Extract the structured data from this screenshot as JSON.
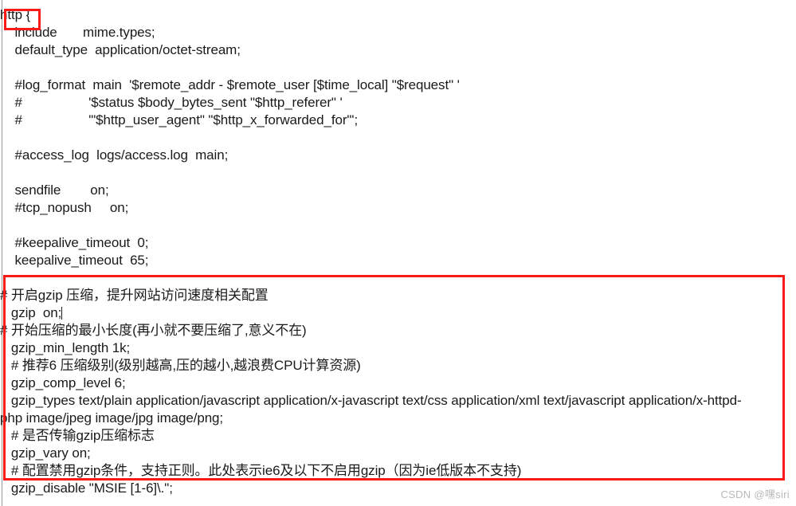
{
  "document": {
    "type": "nginx-config-file",
    "font_color": "#1a1a1a",
    "background": "#ffffff",
    "annotation_color": "#f91a1a",
    "lines": [
      {
        "id": "l01",
        "text": "http {"
      },
      {
        "id": "l02",
        "text": "    include       mime.types;"
      },
      {
        "id": "l03",
        "text": "    default_type  application/octet-stream;"
      },
      {
        "id": "l04",
        "text": ""
      },
      {
        "id": "l05",
        "text": "    #log_format  main  '$remote_addr - $remote_user [$time_local] \"$request\" '"
      },
      {
        "id": "l06",
        "text": "    #                  '$status $body_bytes_sent \"$http_referer\" '"
      },
      {
        "id": "l07",
        "text": "    #                  '\"$http_user_agent\" \"$http_x_forwarded_for\"';"
      },
      {
        "id": "l08",
        "text": ""
      },
      {
        "id": "l09",
        "text": "    #access_log  logs/access.log  main;"
      },
      {
        "id": "l10",
        "text": ""
      },
      {
        "id": "l11",
        "text": "    sendfile        on;"
      },
      {
        "id": "l12",
        "text": "    #tcp_nopush     on;"
      },
      {
        "id": "l13",
        "text": ""
      },
      {
        "id": "l14",
        "text": "    #keepalive_timeout  0;"
      },
      {
        "id": "l15",
        "text": "    keepalive_timeout  65;"
      },
      {
        "id": "l16",
        "text": ""
      },
      {
        "id": "l17",
        "text": "# 开启gzip 压缩，提升网站访问速度相关配置"
      },
      {
        "id": "l18",
        "text": "   gzip  on;",
        "has_caret": true
      },
      {
        "id": "l19",
        "text": "# 开始压缩的最小长度(再小就不要压缩了,意义不在)"
      },
      {
        "id": "l20",
        "text": "   gzip_min_length 1k;"
      },
      {
        "id": "l21",
        "text": "   # 推荐6 压缩级别(级别越高,压的越小,越浪费CPU计算资源)"
      },
      {
        "id": "l22",
        "text": "   gzip_comp_level 6;"
      },
      {
        "id": "l23",
        "text": "   gzip_types text/plain application/javascript application/x-javascript text/css application/xml text/javascript application/x-httpd-"
      },
      {
        "id": "l24",
        "text": "php image/jpeg image/jpg image/png;"
      },
      {
        "id": "l25",
        "text": "   # 是否传输gzip压缩标志"
      },
      {
        "id": "l26",
        "text": "   gzip_vary on;"
      },
      {
        "id": "l27",
        "text": "   # 配置禁用gzip条件，支持正则。此处表示ie6及以下不启用gzip（因为ie低版本不支持)"
      },
      {
        "id": "l28",
        "text": "   gzip_disable \"MSIE [1-6]\\.\";"
      }
    ]
  },
  "annotations": [
    {
      "id": "redbox-http",
      "label": "highlight-http-block-opening"
    },
    {
      "id": "redbox-gzip",
      "label": "highlight-gzip-configuration-block"
    }
  ],
  "watermark": {
    "text": "CSDN @嘿siri"
  }
}
